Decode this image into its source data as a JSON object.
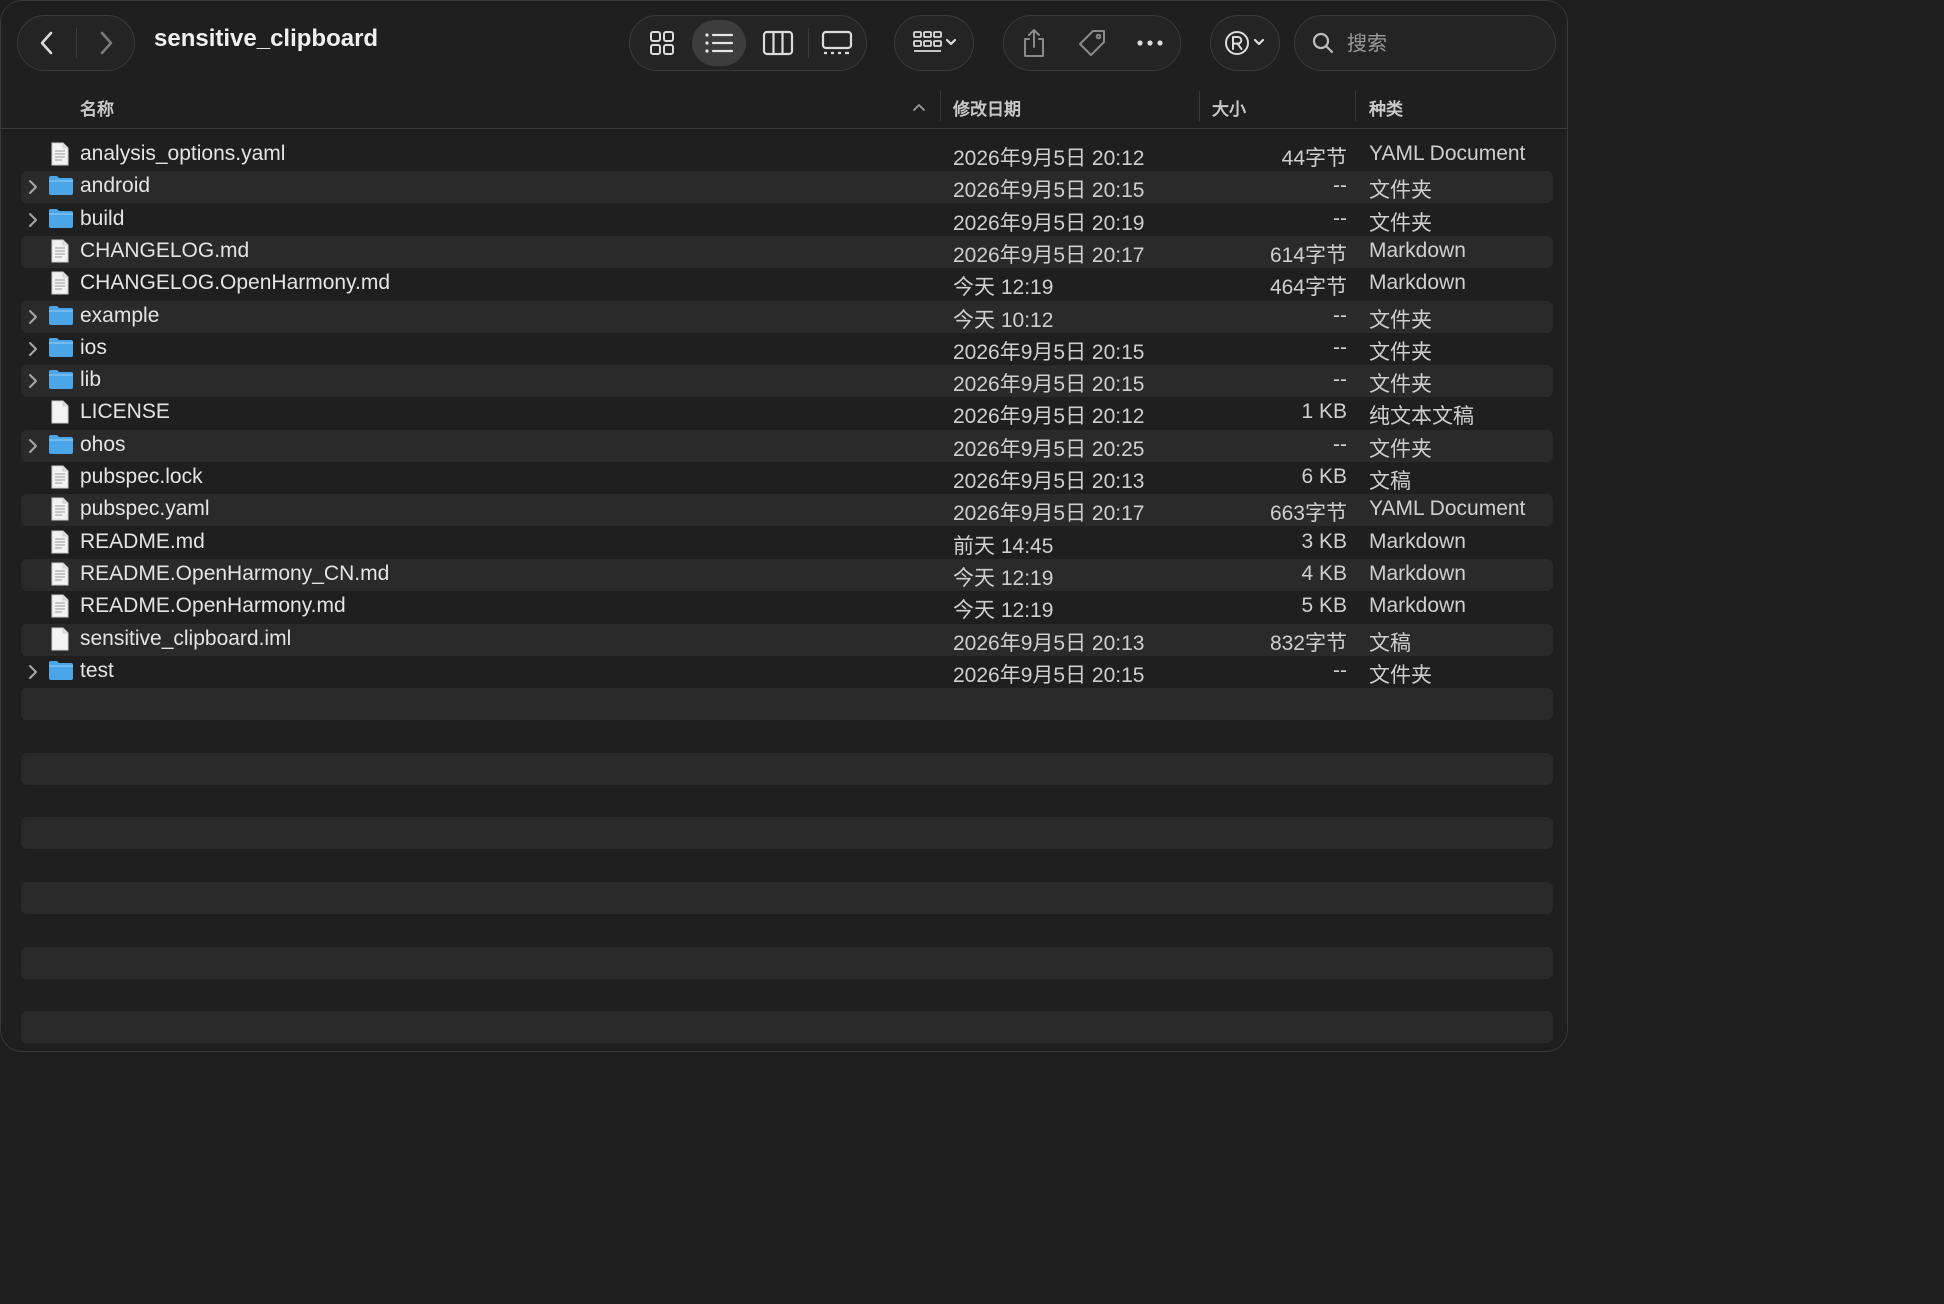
{
  "window": {
    "title": "sensitive_clipboard"
  },
  "toolbar": {
    "back_icon": "chevron-left-icon",
    "forward_icon": "chevron-right-icon",
    "views": [
      "icon-view-icon",
      "list-view-icon",
      "column-view-icon",
      "gallery-view-icon"
    ],
    "selected_view": "list-view-icon",
    "group_icon": "group-by-icon",
    "share_icon": "share-icon",
    "tag_icon": "tag-icon",
    "more_icon": "more-icon",
    "account_icon": "registered-icon",
    "search": {
      "placeholder": "搜索"
    }
  },
  "columns": {
    "name": "名称",
    "date": "修改日期",
    "size": "大小",
    "kind": "种类"
  },
  "files": [
    {
      "name": "analysis_options.yaml",
      "date": "2026年9月5日 20:12",
      "size": "44字节",
      "kind": "YAML Document",
      "type": "file"
    },
    {
      "name": "android",
      "date": "2026年9月5日 20:15",
      "size": "--",
      "kind": "文件夹",
      "type": "folder"
    },
    {
      "name": "build",
      "date": "2026年9月5日 20:19",
      "size": "--",
      "kind": "文件夹",
      "type": "folder"
    },
    {
      "name": "CHANGELOG.md",
      "date": "2026年9月5日 20:17",
      "size": "614字节",
      "kind": "Markdown",
      "type": "file"
    },
    {
      "name": "CHANGELOG.OpenHarmony.md",
      "date": "今天 12:19",
      "size": "464字节",
      "kind": "Markdown",
      "type": "file"
    },
    {
      "name": "example",
      "date": "今天 10:12",
      "size": "--",
      "kind": "文件夹",
      "type": "folder"
    },
    {
      "name": "ios",
      "date": "2026年9月5日 20:15",
      "size": "--",
      "kind": "文件夹",
      "type": "folder"
    },
    {
      "name": "lib",
      "date": "2026年9月5日 20:15",
      "size": "--",
      "kind": "文件夹",
      "type": "folder"
    },
    {
      "name": "LICENSE",
      "date": "2026年9月5日 20:12",
      "size": "1 KB",
      "kind": "纯文本文稿",
      "type": "blank"
    },
    {
      "name": "ohos",
      "date": "2026年9月5日 20:25",
      "size": "--",
      "kind": "文件夹",
      "type": "folder"
    },
    {
      "name": "pubspec.lock",
      "date": "2026年9月5日 20:13",
      "size": "6 KB",
      "kind": "文稿",
      "type": "file"
    },
    {
      "name": "pubspec.yaml",
      "date": "2026年9月5日 20:17",
      "size": "663字节",
      "kind": "YAML Document",
      "type": "file"
    },
    {
      "name": "README.md",
      "date": "前天 14:45",
      "size": "3 KB",
      "kind": "Markdown",
      "type": "file"
    },
    {
      "name": "README.OpenHarmony_CN.md",
      "date": "今天 12:19",
      "size": "4 KB",
      "kind": "Markdown",
      "type": "file"
    },
    {
      "name": "README.OpenHarmony.md",
      "date": "今天 12:19",
      "size": "5 KB",
      "kind": "Markdown",
      "type": "file"
    },
    {
      "name": "sensitive_clipboard.iml",
      "date": "2026年9月5日 20:13",
      "size": "832字节",
      "kind": "文稿",
      "type": "blank"
    },
    {
      "name": "test",
      "date": "2026年9月5日 20:15",
      "size": "--",
      "kind": "文件夹",
      "type": "folder"
    }
  ],
  "colors": {
    "folder": "#4aa6e8",
    "window_bg": "#1f1f1f",
    "row_alt": "#2a2a2a"
  }
}
